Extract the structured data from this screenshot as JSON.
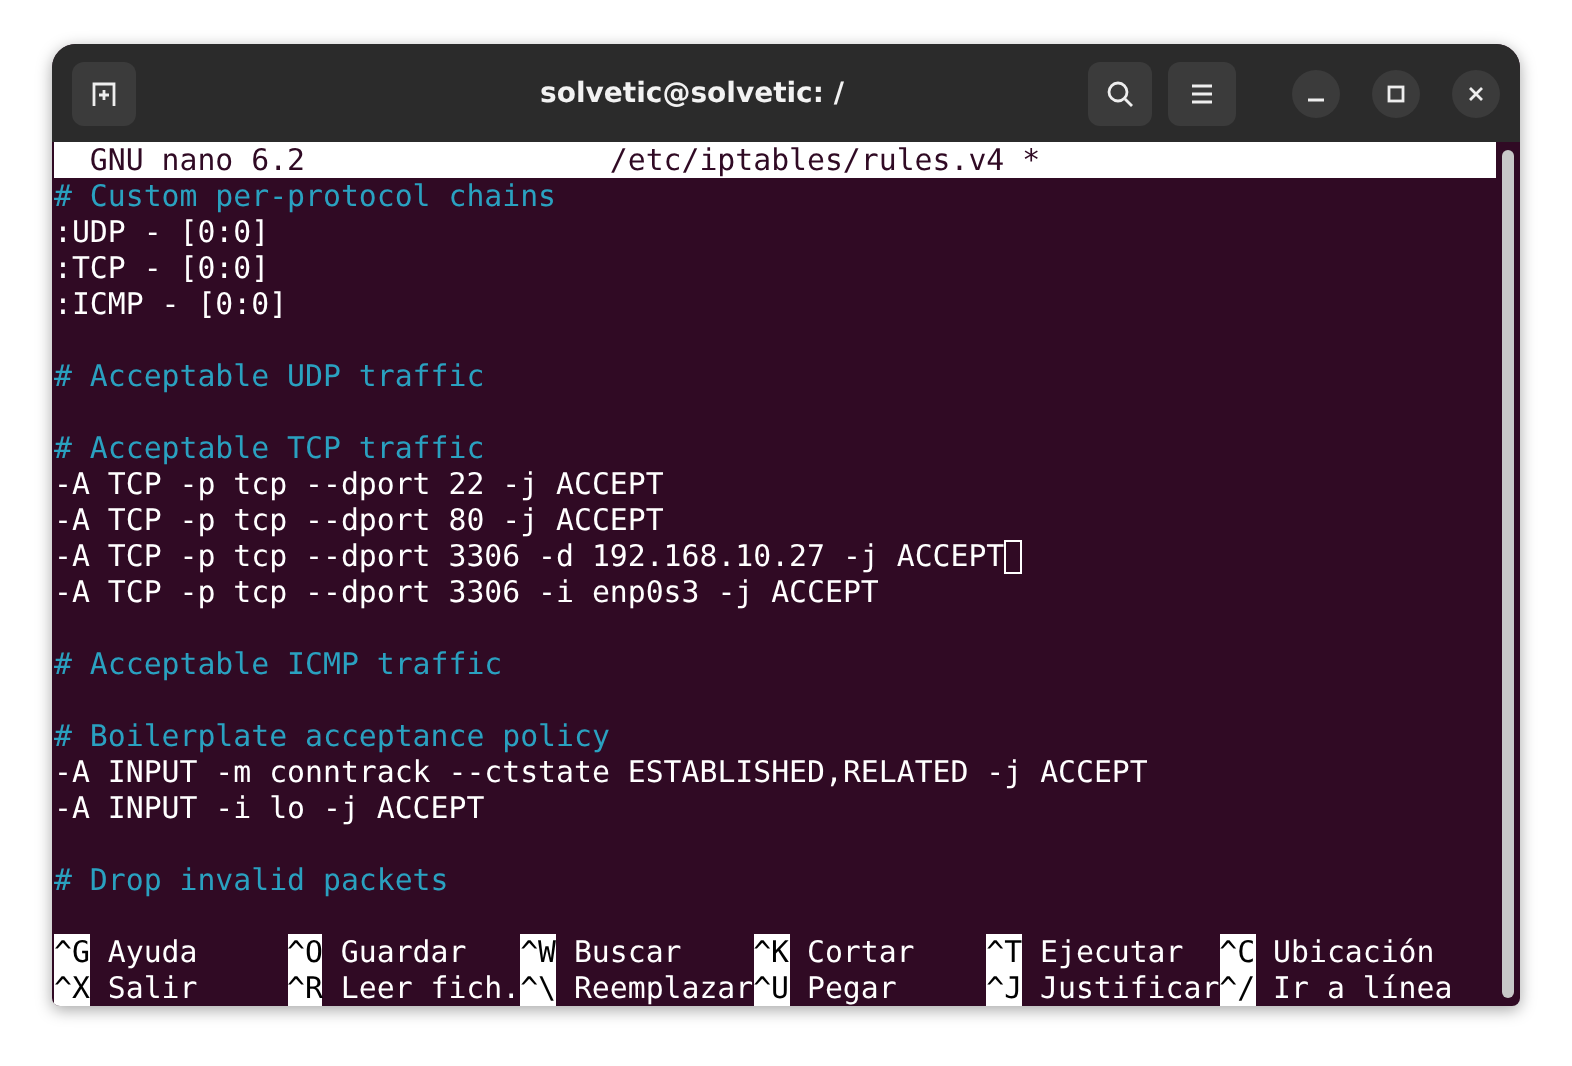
{
  "window": {
    "title": "solvetic@solvetic: /"
  },
  "editor": {
    "app": "GNU nano 6.2",
    "filename": "/etc/iptables/rules.v4 *",
    "lines": [
      {
        "kind": "comment",
        "text": "# Custom per-protocol chains",
        "cursor": false
      },
      {
        "kind": "code",
        "text": ":UDP - [0:0]",
        "cursor": false
      },
      {
        "kind": "code",
        "text": ":TCP - [0:0]",
        "cursor": false
      },
      {
        "kind": "code",
        "text": ":ICMP - [0:0]",
        "cursor": false
      },
      {
        "kind": "blank",
        "cursor": false
      },
      {
        "kind": "comment",
        "text": "# Acceptable UDP traffic",
        "cursor": false
      },
      {
        "kind": "blank",
        "cursor": false
      },
      {
        "kind": "comment",
        "text": "# Acceptable TCP traffic",
        "cursor": false
      },
      {
        "kind": "code",
        "text": "-A TCP -p tcp --dport 22 -j ACCEPT",
        "cursor": false
      },
      {
        "kind": "code",
        "text": "-A TCP -p tcp --dport 80 -j ACCEPT",
        "cursor": false
      },
      {
        "kind": "code",
        "text": "-A TCP -p tcp --dport 3306 -d 192.168.10.27 -j ACCEPT",
        "cursor": true
      },
      {
        "kind": "code",
        "text": "-A TCP -p tcp --dport 3306 -i enp0s3 -j ACCEPT",
        "cursor": false
      },
      {
        "kind": "blank",
        "cursor": false
      },
      {
        "kind": "comment",
        "text": "# Acceptable ICMP traffic",
        "cursor": false
      },
      {
        "kind": "blank",
        "cursor": false
      },
      {
        "kind": "comment",
        "text": "# Boilerplate acceptance policy",
        "cursor": false
      },
      {
        "kind": "code",
        "text": "-A INPUT -m conntrack --ctstate ESTABLISHED,RELATED -j ACCEPT",
        "cursor": false
      },
      {
        "kind": "code",
        "text": "-A INPUT -i lo -j ACCEPT",
        "cursor": false
      },
      {
        "kind": "blank",
        "cursor": false
      },
      {
        "kind": "comment",
        "text": "# Drop invalid packets",
        "cursor": false
      },
      {
        "kind": "blank",
        "cursor": false
      }
    ],
    "shortcuts": [
      [
        {
          "key": "^G",
          "label": "Ayuda"
        },
        {
          "key": "^O",
          "label": "Guardar"
        },
        {
          "key": "^W",
          "label": "Buscar"
        },
        {
          "key": "^K",
          "label": "Cortar"
        },
        {
          "key": "^T",
          "label": "Ejecutar"
        },
        {
          "key": "^C",
          "label": "Ubicación"
        }
      ],
      [
        {
          "key": "^X",
          "label": "Salir"
        },
        {
          "key": "^R",
          "label": "Leer fich."
        },
        {
          "key": "^\\",
          "label": "Reemplazar"
        },
        {
          "key": "^U",
          "label": "Pegar"
        },
        {
          "key": "^J",
          "label": "Justificar"
        },
        {
          "key": "^/",
          "label": "Ir a línea"
        }
      ]
    ]
  }
}
